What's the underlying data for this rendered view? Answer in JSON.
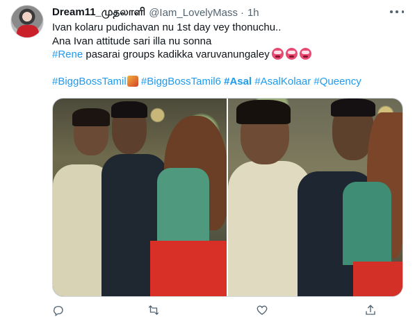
{
  "tweet": {
    "display_name": "Dream11_முதலாளி",
    "handle": "@Iam_LovelyMass",
    "dot": "·",
    "time": "1h",
    "lines": [
      "Ivan kolaru pudichavan nu 1st day vey thonuchu..",
      "Ana Ivan attitude sari illa nu sonna"
    ],
    "rene_tag": "#Rene",
    "rene_rest": " pasarai groups kadikka varuvanungaley",
    "hashtags": {
      "bigg_boss_tamil": "#BiggBossTamil",
      "bigg_boss_tamil6": "#BiggBossTamil6",
      "asal": "#Asal",
      "asal_kolaar": "#AsalKolaar",
      "queency": "#Queency"
    },
    "emoji_icon": "angry-face-emoji",
    "bigg_boss_icon": "bigg-boss-logo-icon"
  },
  "actions": [
    {
      "name": "reply-icon"
    },
    {
      "name": "retweet-icon"
    },
    {
      "name": "like-icon"
    },
    {
      "name": "share-icon"
    }
  ],
  "colors": {
    "link": "#1d9bf0",
    "text": "#0f1419",
    "secondary": "#536471",
    "border": "#cfd9de"
  }
}
